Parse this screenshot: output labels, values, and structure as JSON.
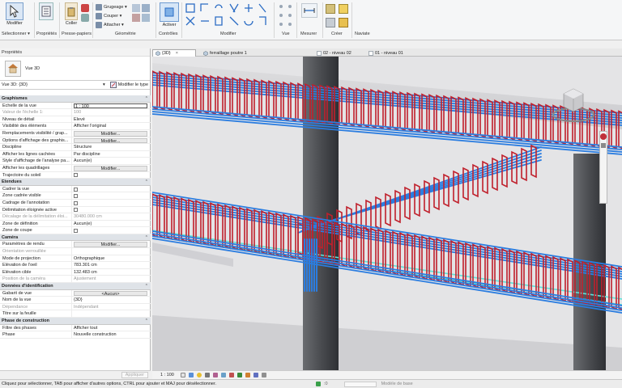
{
  "ribbon": {
    "modify_label": "Modifier",
    "properties_label": "Propriétés",
    "paste_label": "Coller",
    "cut_label": "Grugeage",
    "cope_label": "Couper",
    "join_label": "Attacher",
    "activate_label": "Activer",
    "panels": {
      "select": "Sélectionner",
      "properties": "Propriétés",
      "clipboard": "Presse-papiers",
      "geometry": "Géométrie",
      "controls": "Contrôles",
      "modify": "Modifier",
      "view": "Vue",
      "measure": "Mesurer",
      "create": "Créer",
      "navigate": "Naviate"
    }
  },
  "properties": {
    "title": "Propriétés",
    "type_name": "Vue 3D",
    "instance_label": "Vue 3D: {3D}",
    "edit_type_label": "Modifier le type",
    "groups": [
      {
        "title": "Graphismes",
        "rows": [
          {
            "key": "Echelle de la vue",
            "value": "1 : 100",
            "kind": "input"
          },
          {
            "key": "Valeur de l'échelle    1:",
            "value": "100",
            "kind": "dim"
          },
          {
            "key": "Niveau de détail",
            "value": "Elevé",
            "kind": "text"
          },
          {
            "key": "Visibilité des éléments",
            "value": "Afficher l'original",
            "kind": "text"
          },
          {
            "key": "Remplacements visibilité / grap...",
            "value": "Modifier...",
            "kind": "button"
          },
          {
            "key": "Options d'affichage des graphis...",
            "value": "Modifier...",
            "kind": "button"
          },
          {
            "key": "Discipline",
            "value": "Structure",
            "kind": "text"
          },
          {
            "key": "Afficher les lignes cachées",
            "value": "Par discipline",
            "kind": "text"
          },
          {
            "key": "Style d'affichage de l'analyse pa...",
            "value": "Aucun(e)",
            "kind": "text"
          },
          {
            "key": "Afficher les quadrillages",
            "value": "Modifier...",
            "kind": "button"
          },
          {
            "key": "Trajectoire du soleil",
            "value": "",
            "kind": "check"
          }
        ]
      },
      {
        "title": "Etendues",
        "rows": [
          {
            "key": "Cadrer la vue",
            "value": "",
            "kind": "check"
          },
          {
            "key": "Zone cadrée visible",
            "value": "",
            "kind": "check"
          },
          {
            "key": "Cadrage de l'annotation",
            "value": "",
            "kind": "check"
          },
          {
            "key": "Délimitation éloignée active",
            "value": "",
            "kind": "check"
          },
          {
            "key": "Décalage de la délimitation éloi...",
            "value": "30480.000 cm",
            "kind": "dim"
          },
          {
            "key": "Zone de définition",
            "value": "Aucun(e)",
            "kind": "text"
          },
          {
            "key": "Zone de coupe",
            "value": "",
            "kind": "check"
          }
        ]
      },
      {
        "title": "Caméra",
        "rows": [
          {
            "key": "Paramètres de rendu",
            "value": "Modifier...",
            "kind": "button"
          },
          {
            "key": "Orientation verrouillée",
            "value": "",
            "kind": "dim"
          },
          {
            "key": "Mode de projection",
            "value": "Orthographique",
            "kind": "text"
          },
          {
            "key": "Elévation de l'oeil",
            "value": "783.301 cm",
            "kind": "text"
          },
          {
            "key": "Elévation cible",
            "value": "132.483 cm",
            "kind": "text"
          },
          {
            "key": "Position de la caméra",
            "value": "Ajustement",
            "kind": "dim"
          }
        ]
      },
      {
        "title": "Données d'identification",
        "rows": [
          {
            "key": "Gabarit de vue",
            "value": "<Aucun>",
            "kind": "button"
          },
          {
            "key": "Nom de la vue",
            "value": "{3D}",
            "kind": "text"
          },
          {
            "key": "Dépendance",
            "value": "Indépendant",
            "kind": "dim"
          },
          {
            "key": "Titre sur la feuille",
            "value": "",
            "kind": "text"
          }
        ]
      },
      {
        "title": "Phase de construction",
        "rows": [
          {
            "key": "Filtre des phases",
            "value": "Afficher tout",
            "kind": "text"
          },
          {
            "key": "Phase",
            "value": "Nouvelle construction",
            "kind": "text"
          }
        ]
      }
    ],
    "help_link": "",
    "apply_label": "Appliquer"
  },
  "tabs": [
    {
      "label": "{3D}",
      "active": true
    },
    {
      "label": "ferraillage poutre 1",
      "active": false
    },
    {
      "label": "02 - niveau 02",
      "active": false
    },
    {
      "label": "01 - niveau 01",
      "active": false
    }
  ],
  "view_bar": {
    "scale": "1 : 100"
  },
  "status": {
    "hint": "Cliquez pour sélectionner, TAB pour afficher d'autres options, CTRL pour ajouter et MAJ pour désélectionner.",
    "zero": ":0",
    "model": "Modèle de base"
  },
  "colors": {
    "rebar_red": "#c0202c",
    "rebar_blue": "#2b7de0",
    "rebar_cyan": "#5ee0d8",
    "column_gray": "#5a5c60",
    "ribbon_accent": "#2b6cc4"
  }
}
